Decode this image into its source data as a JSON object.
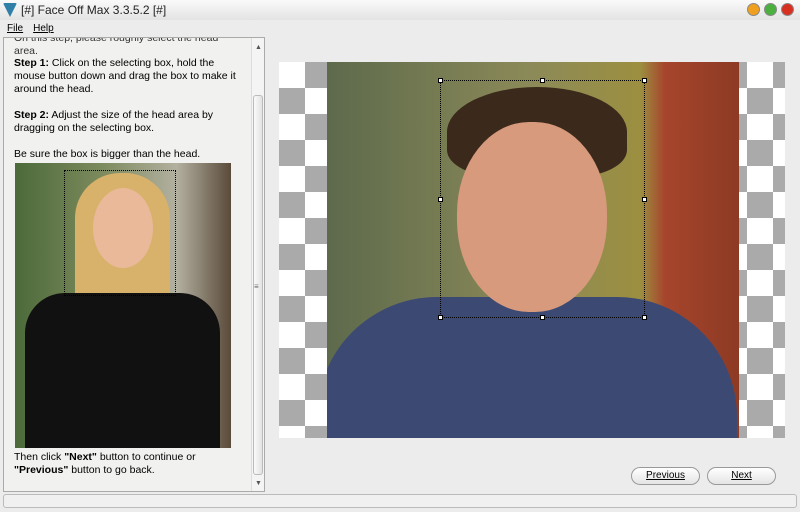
{
  "window": {
    "title": "[#] Face Off Max  3.3.5.2 [#]"
  },
  "menu": [
    "File",
    "Help"
  ],
  "instructions": {
    "intro": "On this step, please roughly select the head area.",
    "step1_label": "Step 1:",
    "step1_text": " Click on the selecting box, hold the mouse button down and drag the box to make it around the head.",
    "step2_label": "Step 2:",
    "step2_text": " Adjust the size of the head area by dragging on the selecting box.",
    "note": "Be sure the box is bigger than the head.",
    "then_a": "Then click ",
    "then_next": "\"Next\"",
    "then_b": " button to continue or ",
    "then_prev": "\"Previous\"",
    "then_c": " button to go back."
  },
  "buttons": {
    "previous": "Previous",
    "next": "Next"
  }
}
